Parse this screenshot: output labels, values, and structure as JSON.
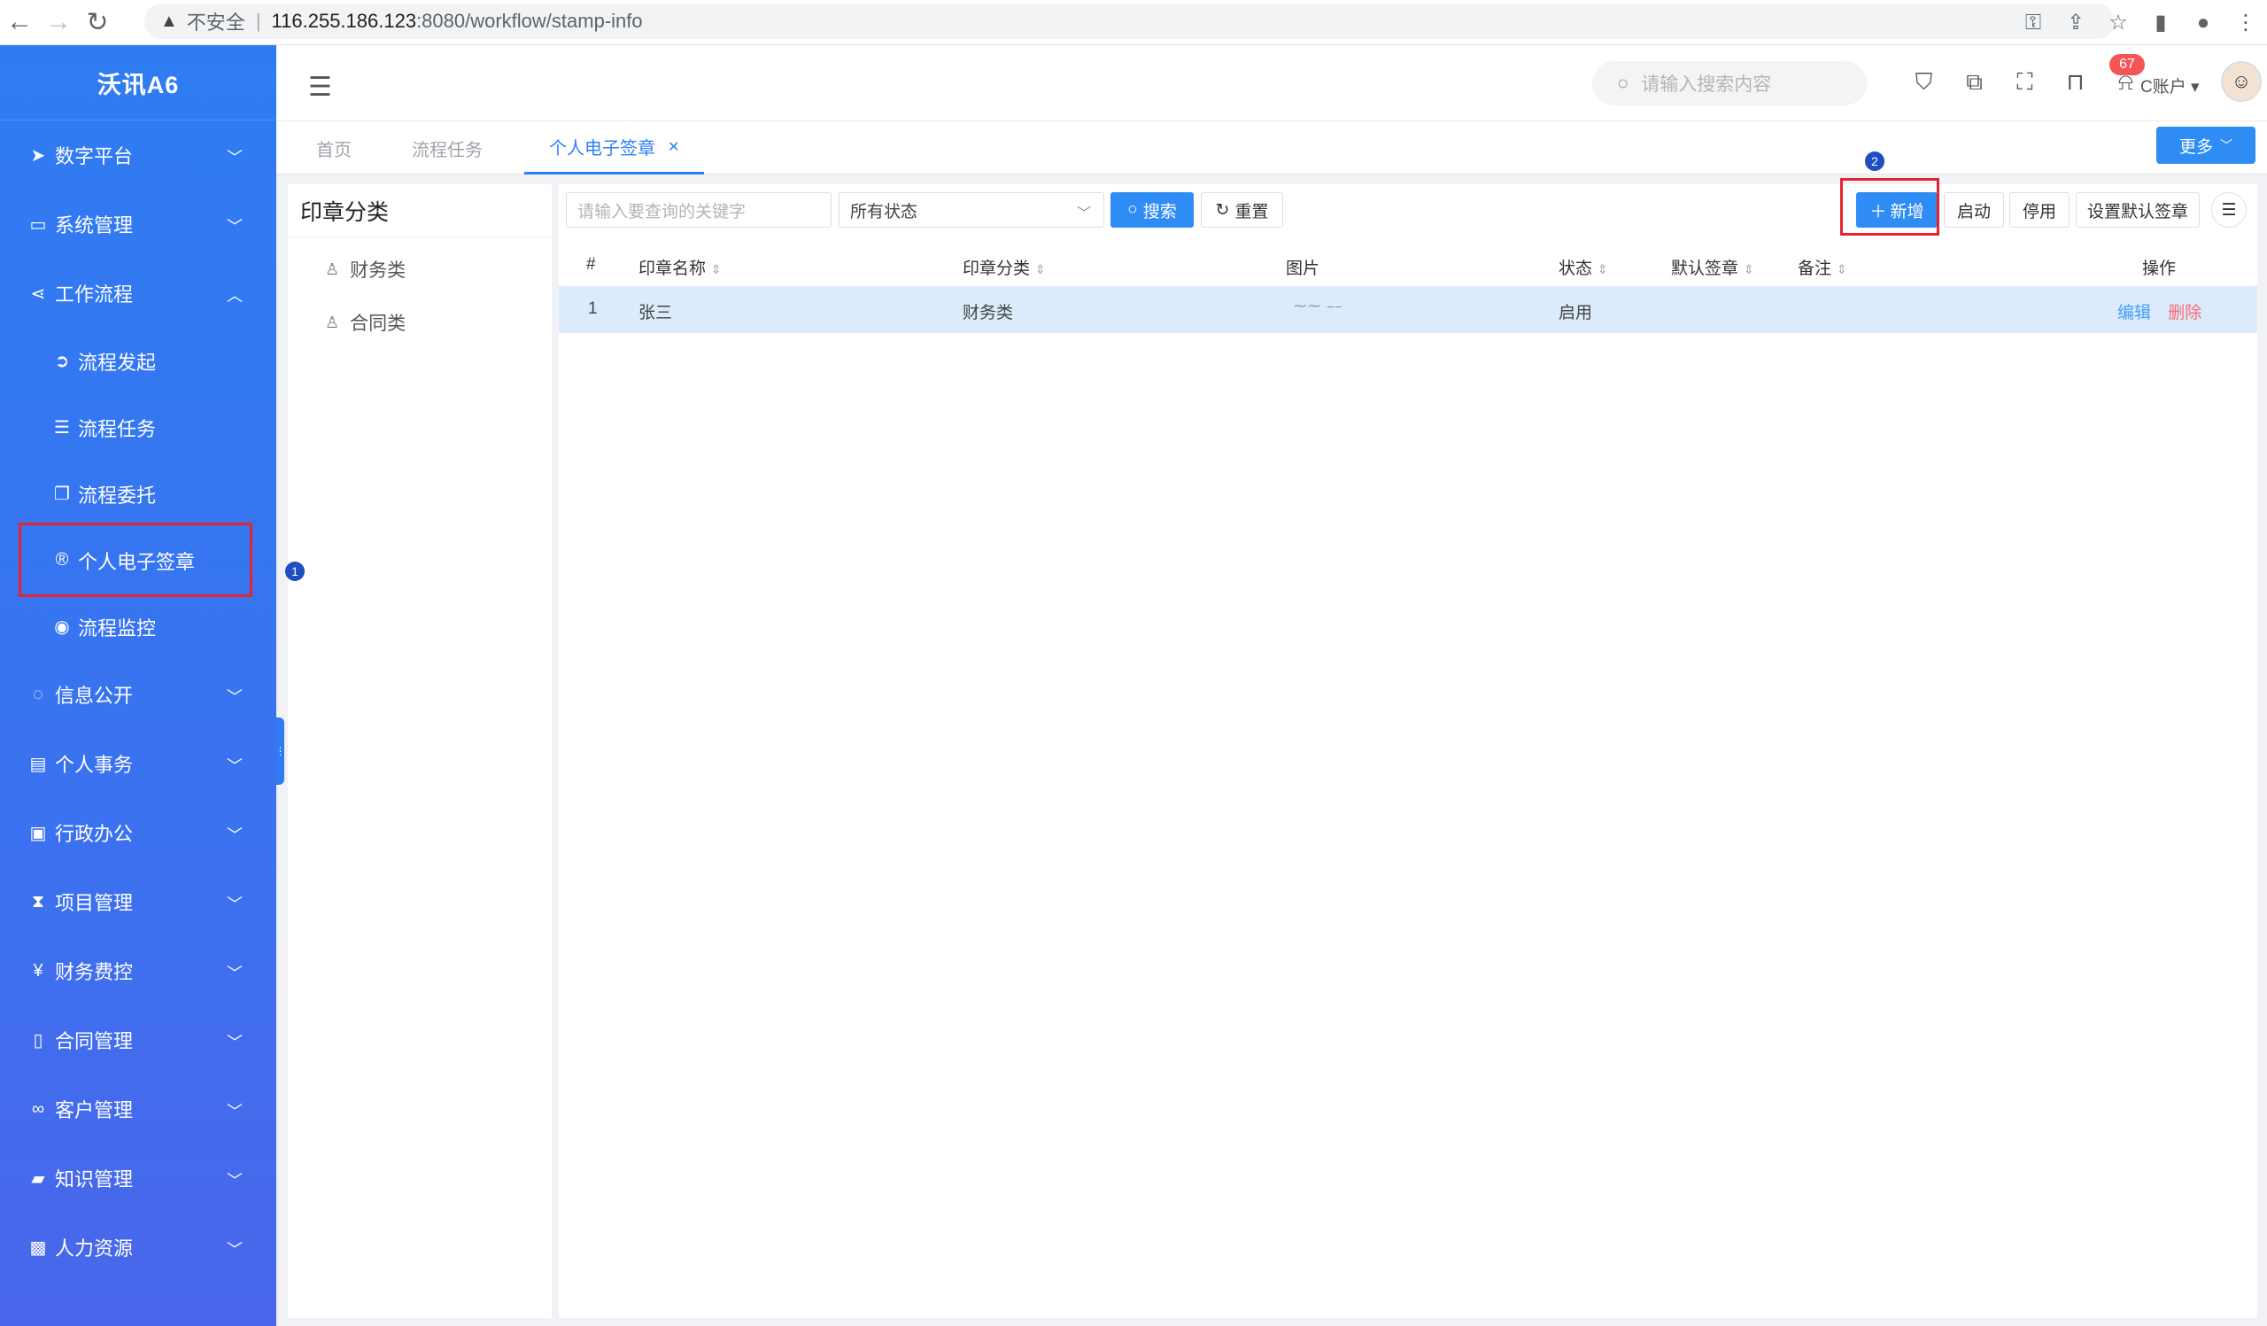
{
  "browser": {
    "insecure_label": "不安全",
    "url_host": "116.255.186.123",
    "url_path": ":8080/workflow/stamp-info"
  },
  "sidebar": {
    "brand": "沃讯A6",
    "items": [
      {
        "label": "数字平台",
        "icon": "paper-plane-icon"
      },
      {
        "label": "系统管理",
        "icon": "monitor-icon"
      },
      {
        "label": "工作流程",
        "icon": "share-icon"
      },
      {
        "label": "信息公开",
        "icon": "chat-icon"
      },
      {
        "label": "个人事务",
        "icon": "id-card-icon"
      },
      {
        "label": "行政办公",
        "icon": "briefcase-icon"
      },
      {
        "label": "项目管理",
        "icon": "hourglass-icon"
      },
      {
        "label": "财务费控",
        "icon": "yen-icon"
      },
      {
        "label": "合同管理",
        "icon": "file-icon"
      },
      {
        "label": "客户管理",
        "icon": "handshake-icon"
      },
      {
        "label": "知识管理",
        "icon": "book-icon"
      },
      {
        "label": "人力资源",
        "icon": "person-icon"
      }
    ],
    "sub_items": [
      {
        "label": "流程发起",
        "icon": "arrow-circle-icon"
      },
      {
        "label": "流程任务",
        "icon": "list-icon"
      },
      {
        "label": "流程委托",
        "icon": "copy-icon"
      },
      {
        "label": "个人电子签章",
        "icon": "registered-icon"
      },
      {
        "label": "流程监控",
        "icon": "eye-icon"
      }
    ]
  },
  "header": {
    "search_placeholder": "请输入搜索内容",
    "notification_count": "67",
    "account_label": "C账户"
  },
  "tabs": [
    {
      "label": "首页"
    },
    {
      "label": "流程任务"
    },
    {
      "label": "个人电子签章"
    }
  ],
  "more_label": "更多",
  "category": {
    "title": "印章分类",
    "items": [
      "财务类",
      "合同类"
    ]
  },
  "steps": {
    "one": "1",
    "two": "2"
  },
  "toolbar": {
    "keyword_placeholder": "请输入要查询的关键字",
    "status_select": "所有状态",
    "search_label": "搜索",
    "reset_label": "重置",
    "add_label": "新增",
    "enable_label": "启动",
    "disable_label": "停用",
    "default_label": "设置默认签章"
  },
  "table": {
    "headers": {
      "index": "#",
      "name": "印章名称",
      "category": "印章分类",
      "image": "图片",
      "status": "状态",
      "default": "默认签章",
      "remark": "备注",
      "actions": "操作"
    },
    "rows": [
      {
        "index": "1",
        "name": "张三",
        "category": "财务类",
        "status": "启用",
        "edit": "编辑",
        "delete": "删除"
      }
    ]
  },
  "colors": {
    "sidebar": "#2f7cf2",
    "primary": "#2f8cf5",
    "highlight": "#e8232e",
    "row_selected": "#dcebfb"
  }
}
